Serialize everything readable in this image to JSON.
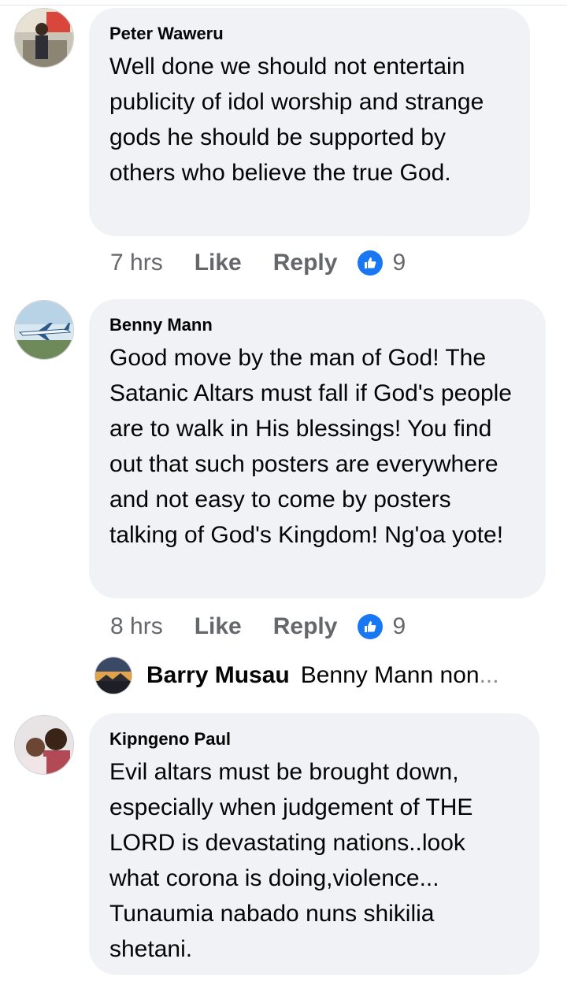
{
  "comments": [
    {
      "author": "Peter Waweru",
      "text": "Well done we should not entertain publicity of idol worship and strange gods he should be supported by others who believe the true God.",
      "time": "7 hrs",
      "like_label": "Like",
      "reply_label": "Reply",
      "reaction_count": "9"
    },
    {
      "author": "Benny Mann",
      "text": "Good move by the man of God! The Satanic Altars must fall if God's people are to walk in His blessings! You find out that such posters are everywhere and not easy to come by posters talking of God's Kingdom! Ng'oa yote!",
      "time": "8 hrs",
      "like_label": "Like",
      "reply_label": "Reply",
      "reaction_count": "9",
      "reply_preview": {
        "author": "Barry Musau",
        "snippet": "Benny Mann non",
        "ellipsis": "..."
      }
    },
    {
      "author": "Kipngeno Paul",
      "text": "Evil altars must be brought down, especially when judgement of THE LORD is devastating nations..look what corona is doing,violence... Tunaumia nabado nuns shikilia shetani."
    }
  ],
  "colors": {
    "bubble": "#f0f2f5",
    "meta_text": "#65676b",
    "like_blue": "#1877f2"
  }
}
